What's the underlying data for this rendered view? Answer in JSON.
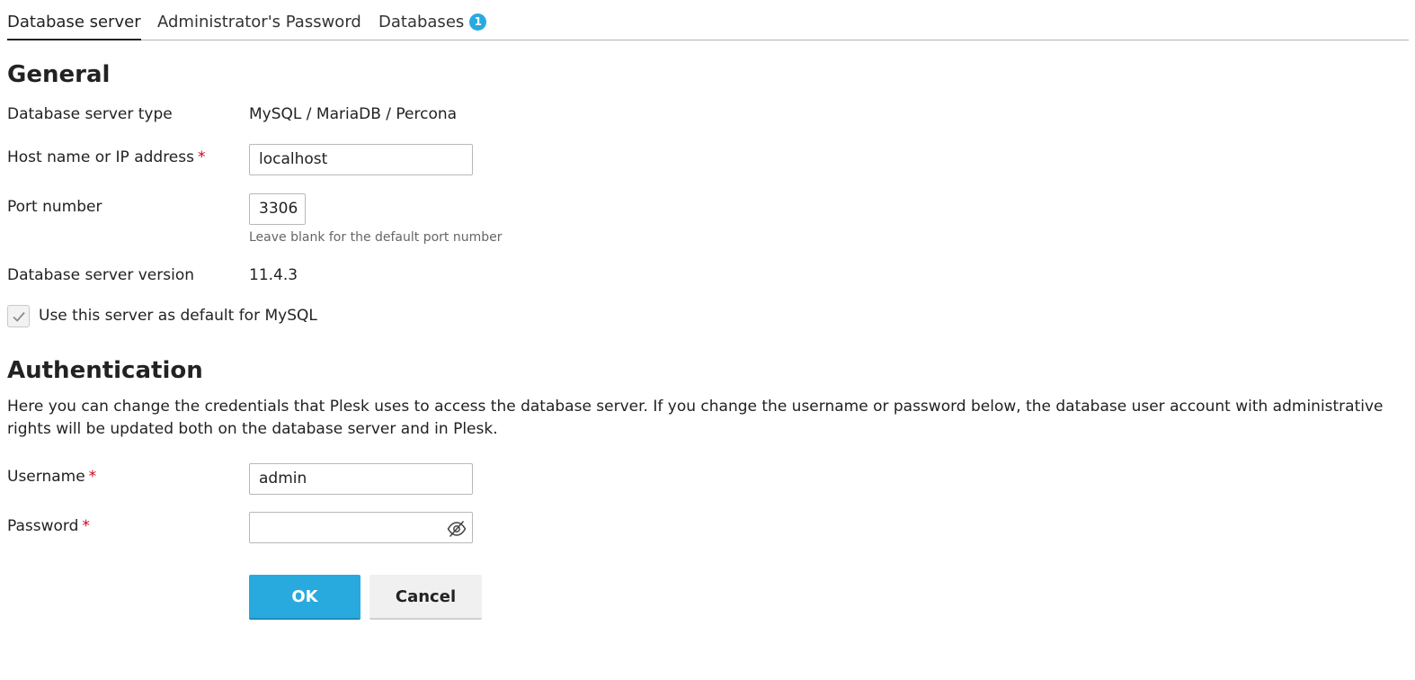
{
  "tabs": [
    {
      "label": "Database server",
      "active": true
    },
    {
      "label": "Administrator's Password",
      "active": false
    },
    {
      "label": "Databases",
      "active": false,
      "badge": "1"
    }
  ],
  "general": {
    "title": "General",
    "server_type_label": "Database server type",
    "server_type_value": "MySQL / MariaDB / Percona",
    "host_label": "Host name or IP address",
    "host_value": "localhost",
    "port_label": "Port number",
    "port_value": "3306",
    "port_hint": "Leave blank for the default port number",
    "version_label": "Database server version",
    "version_value": "11.4.3",
    "default_checkbox_label": "Use this server as default for MySQL",
    "default_checked": true
  },
  "authentication": {
    "title": "Authentication",
    "description": "Here you can change the credentials that Plesk uses to access the database server. If you change the username or password below, the database user account with administrative rights will be updated both on the database server and in Plesk.",
    "username_label": "Username",
    "username_value": "admin",
    "password_label": "Password",
    "password_value": ""
  },
  "required_mark": "*",
  "buttons": {
    "ok": "OK",
    "cancel": "Cancel"
  },
  "colors": {
    "accent": "#28aade",
    "required": "#d0021b"
  },
  "icons": {
    "password_toggle": "eye-slash-icon",
    "checkbox": "check-icon"
  }
}
